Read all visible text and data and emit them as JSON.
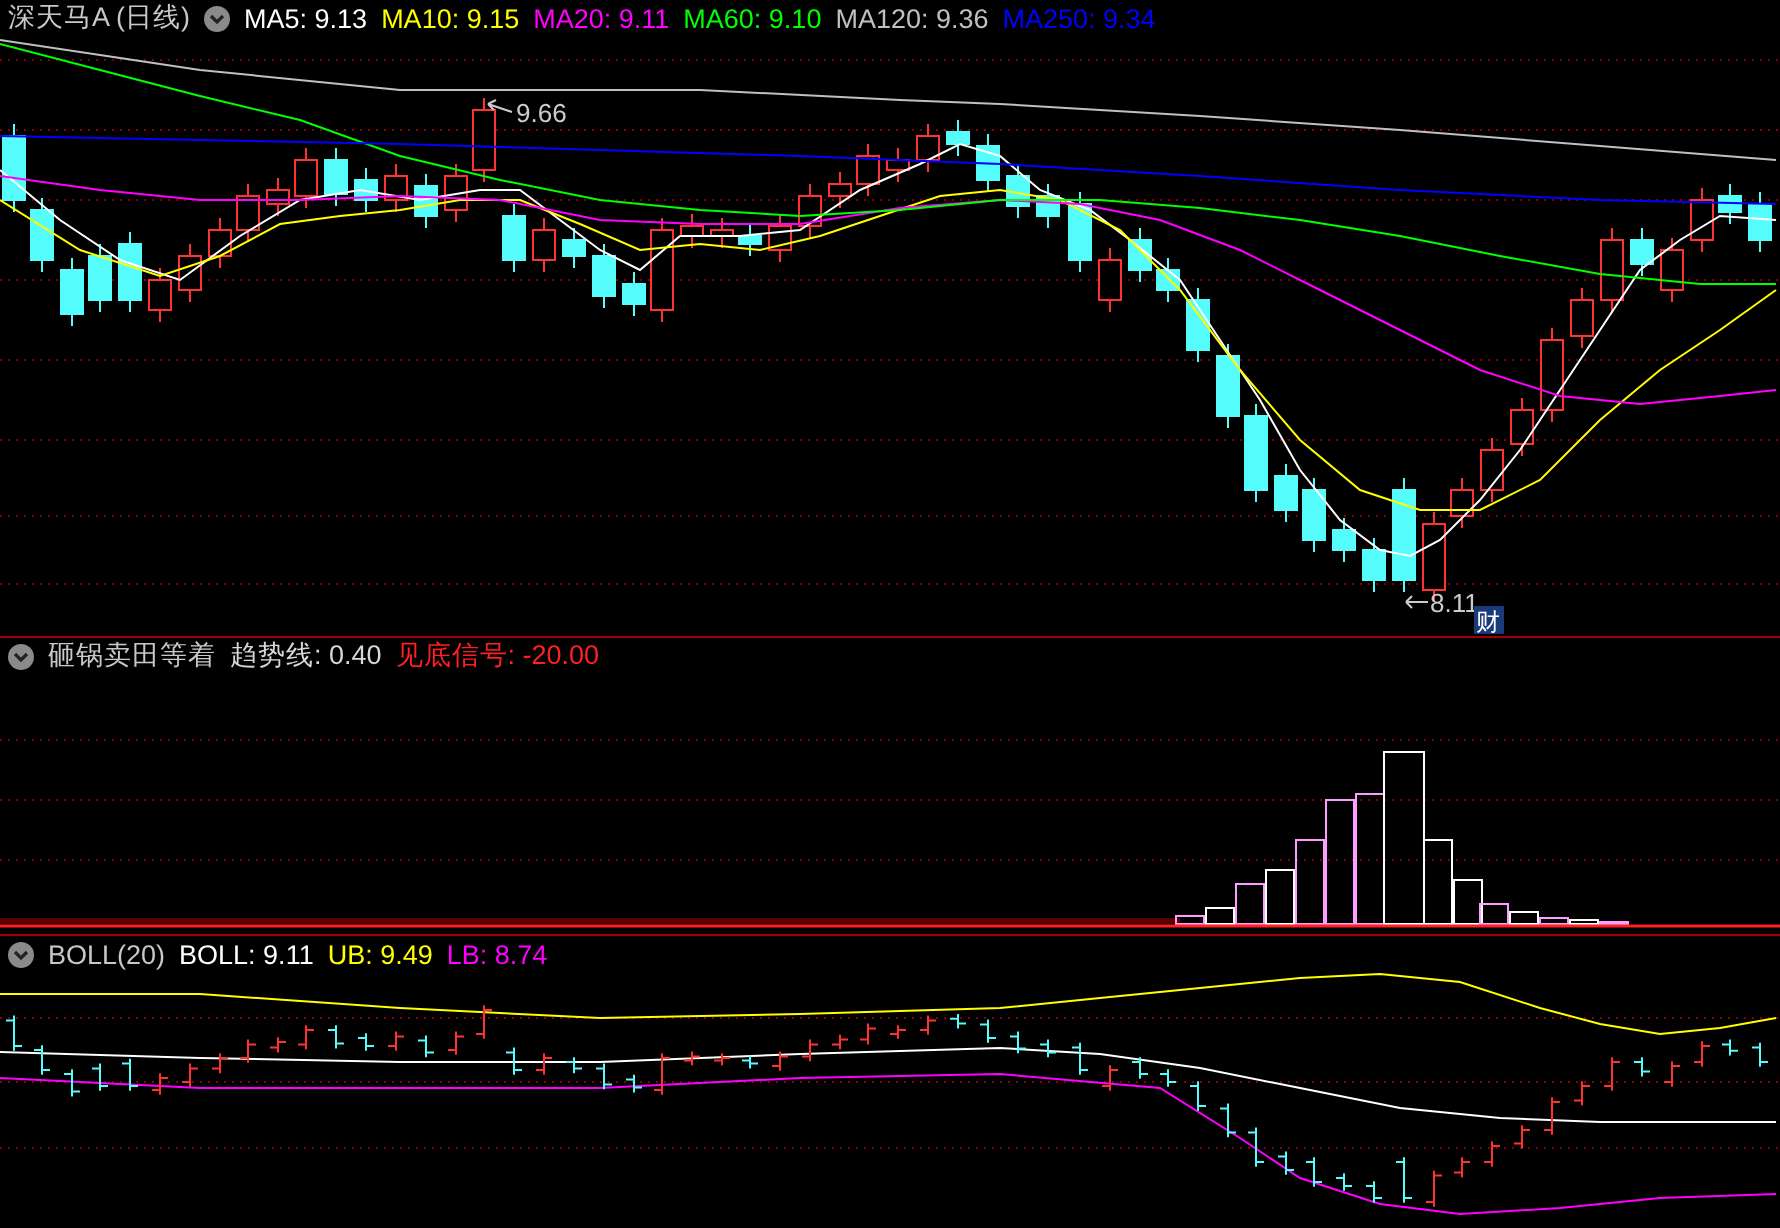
{
  "main_panel": {
    "title": "深天马A (日线)",
    "indicators": [
      {
        "label": "MA5: 9.13",
        "color": "#ffffff"
      },
      {
        "label": "MA10: 9.15",
        "color": "#ffff00"
      },
      {
        "label": "MA20: 9.11",
        "color": "#ff00ff"
      },
      {
        "label": "MA60: 9.10",
        "color": "#00ff00"
      },
      {
        "label": "MA120: 9.36",
        "color": "#c0c0c0"
      },
      {
        "label": "MA250: 9.34",
        "color": "#0000ff"
      }
    ],
    "high_label": "9.66",
    "low_label": "8.11",
    "badge": "财"
  },
  "indicator_panel": {
    "title": "砸锅卖田等着",
    "values": [
      {
        "label": "趋势线: 0.40",
        "color": "#d8d8d8"
      },
      {
        "label": "见底信号: -20.00",
        "color": "#ff2020"
      }
    ]
  },
  "boll_panel": {
    "title": "BOLL(20)",
    "values": [
      {
        "label": "BOLL: 9.11",
        "color": "#ffffff"
      },
      {
        "label": "UB: 9.49",
        "color": "#ffff00"
      },
      {
        "label": "LB: 8.74",
        "color": "#ff00ff"
      }
    ]
  }
}
